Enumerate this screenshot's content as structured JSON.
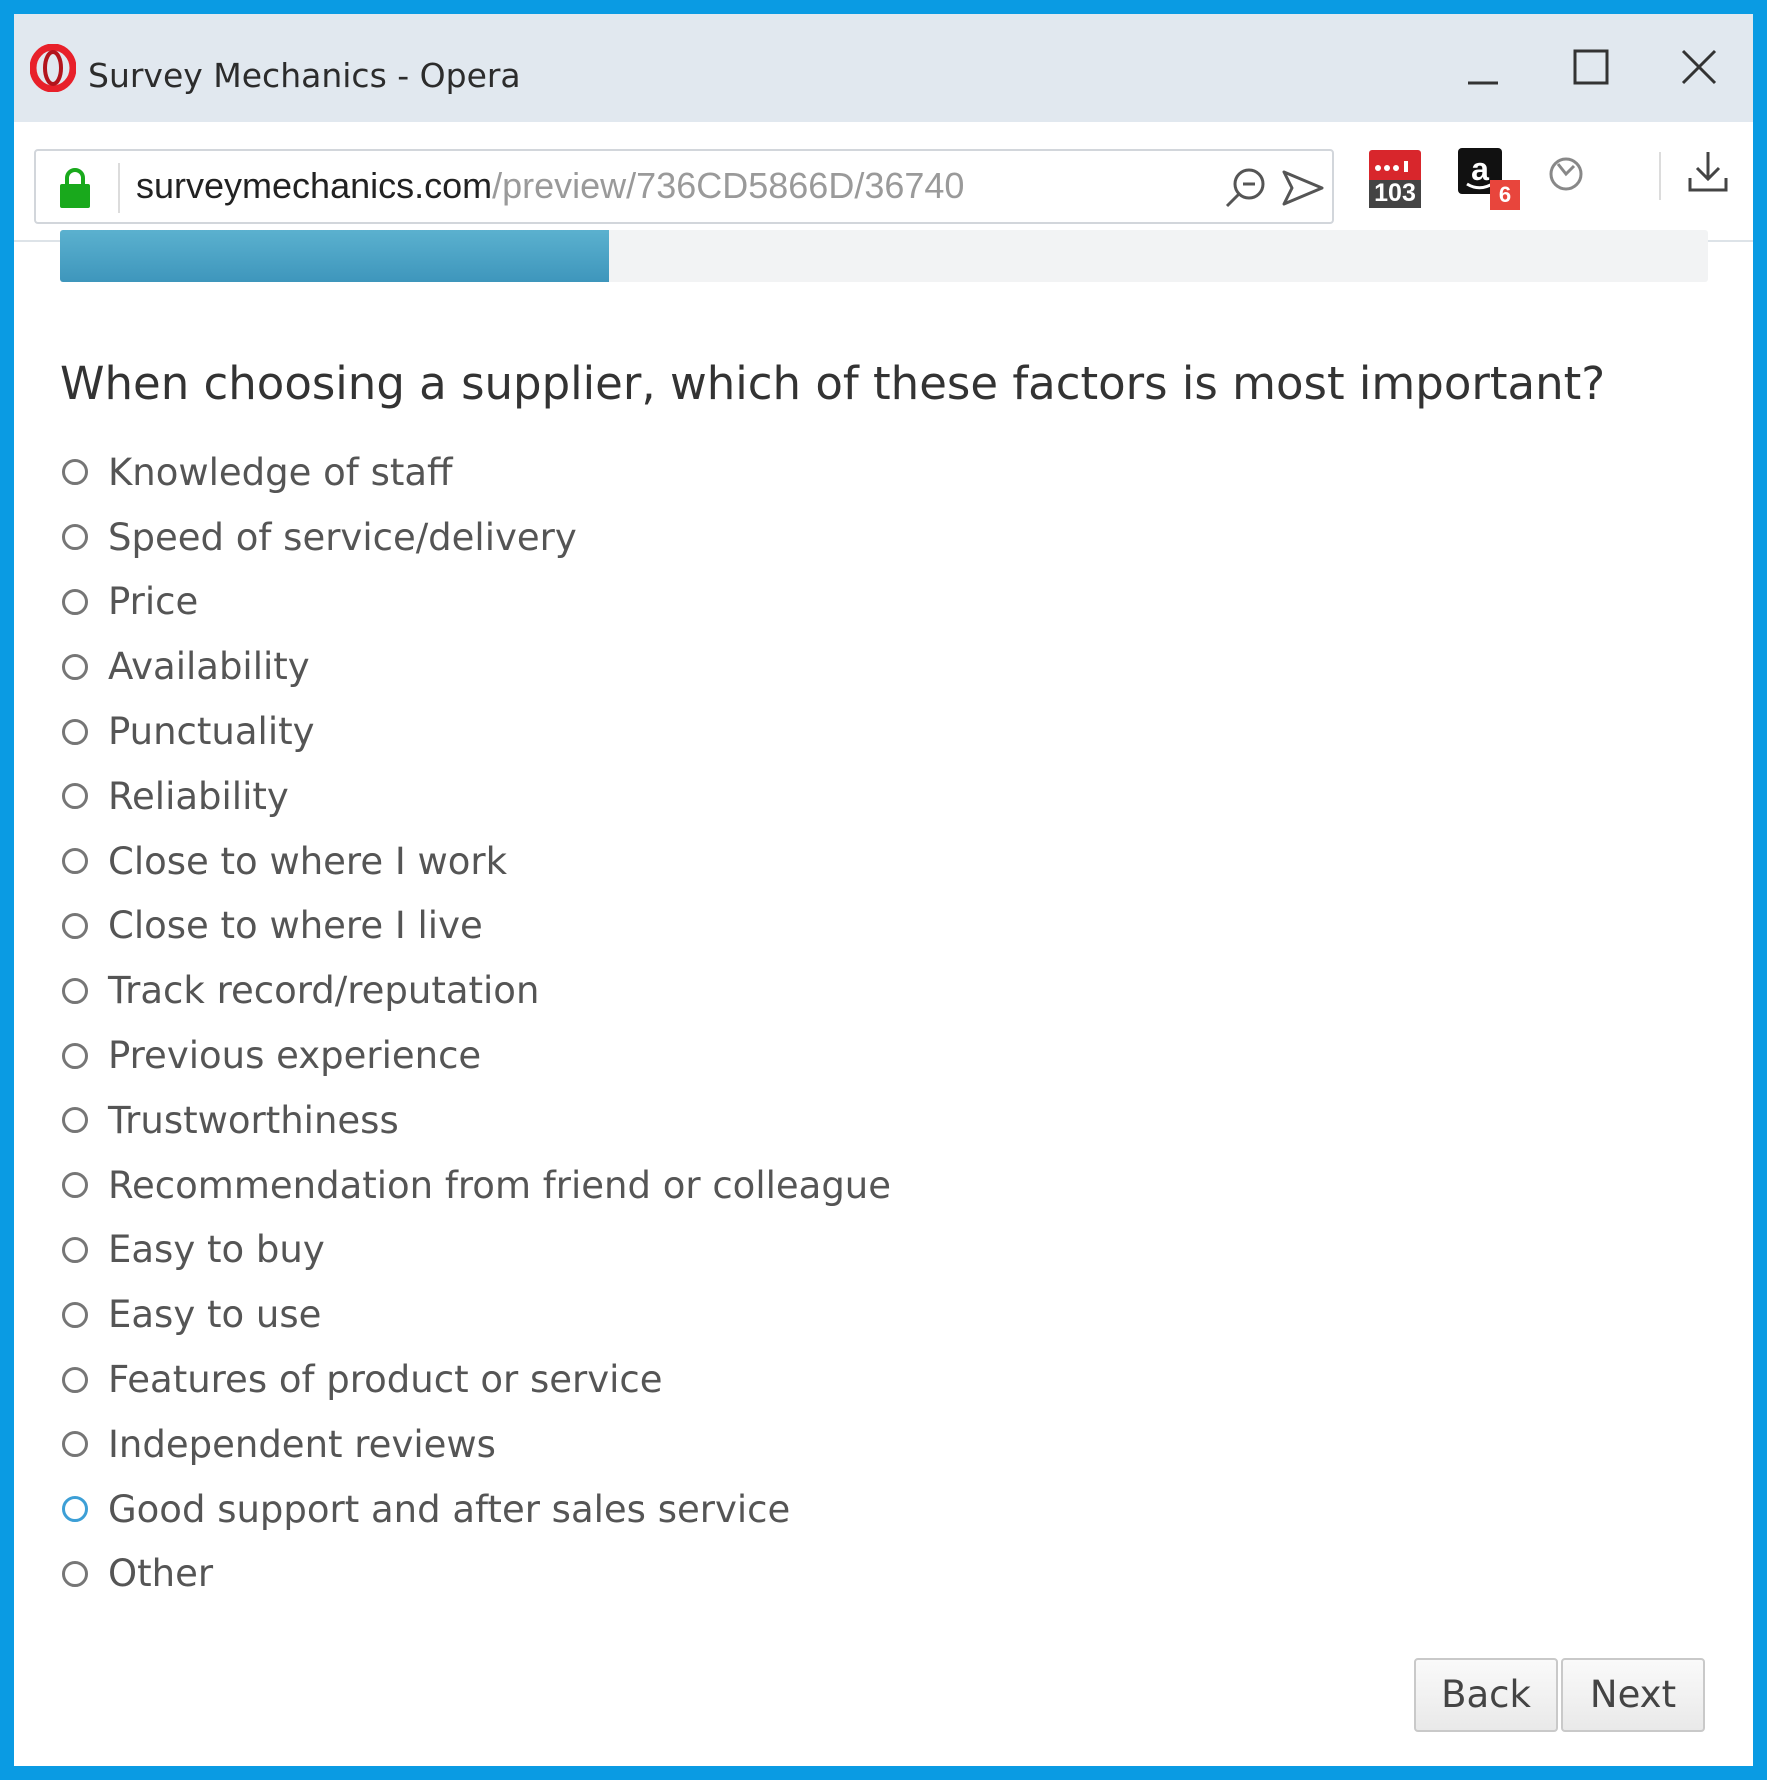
{
  "window": {
    "title": "Survey Mechanics - Opera",
    "logo_icon": "opera-logo-icon",
    "controls": [
      "minimize-icon",
      "maximize-icon",
      "close-icon"
    ]
  },
  "address_bar": {
    "host": "surveymechanics.com",
    "path": "/preview/736CD5866D/36740",
    "secure_icon": "lock-icon",
    "icons": [
      "search-icon",
      "send-icon"
    ]
  },
  "extensions": [
    {
      "icon": "counter-extension-icon",
      "badge": "103",
      "color": "#e0262b"
    },
    {
      "icon": "amazon-extension-icon",
      "badge": "6",
      "color": "#e8453c"
    },
    {
      "icon": "vpn-extension-icon",
      "badge": ""
    }
  ],
  "downloads_icon": "download-icon",
  "progress": {
    "fraction": 0.333,
    "color": "#4aa3c8"
  },
  "survey": {
    "question": "When choosing a supplier, which of these factors is most important?",
    "options": [
      "Knowledge of staff",
      "Speed of service/delivery",
      "Price",
      "Availability",
      "Punctuality",
      "Reliability",
      "Close to where I work",
      "Close to where I live",
      "Track record/reputation",
      "Previous experience",
      "Trustworthiness",
      "Recommendation from friend or colleague",
      "Easy to buy",
      "Easy to use",
      "Features of product or service",
      "Independent reviews",
      "Good support and after sales service",
      "Other"
    ],
    "focused_option": "Good support and after sales service"
  },
  "nav": {
    "back_label": "Back",
    "next_label": "Next"
  },
  "colors": {
    "frame": "#0a9be3",
    "accent": "#3d9fd6"
  }
}
